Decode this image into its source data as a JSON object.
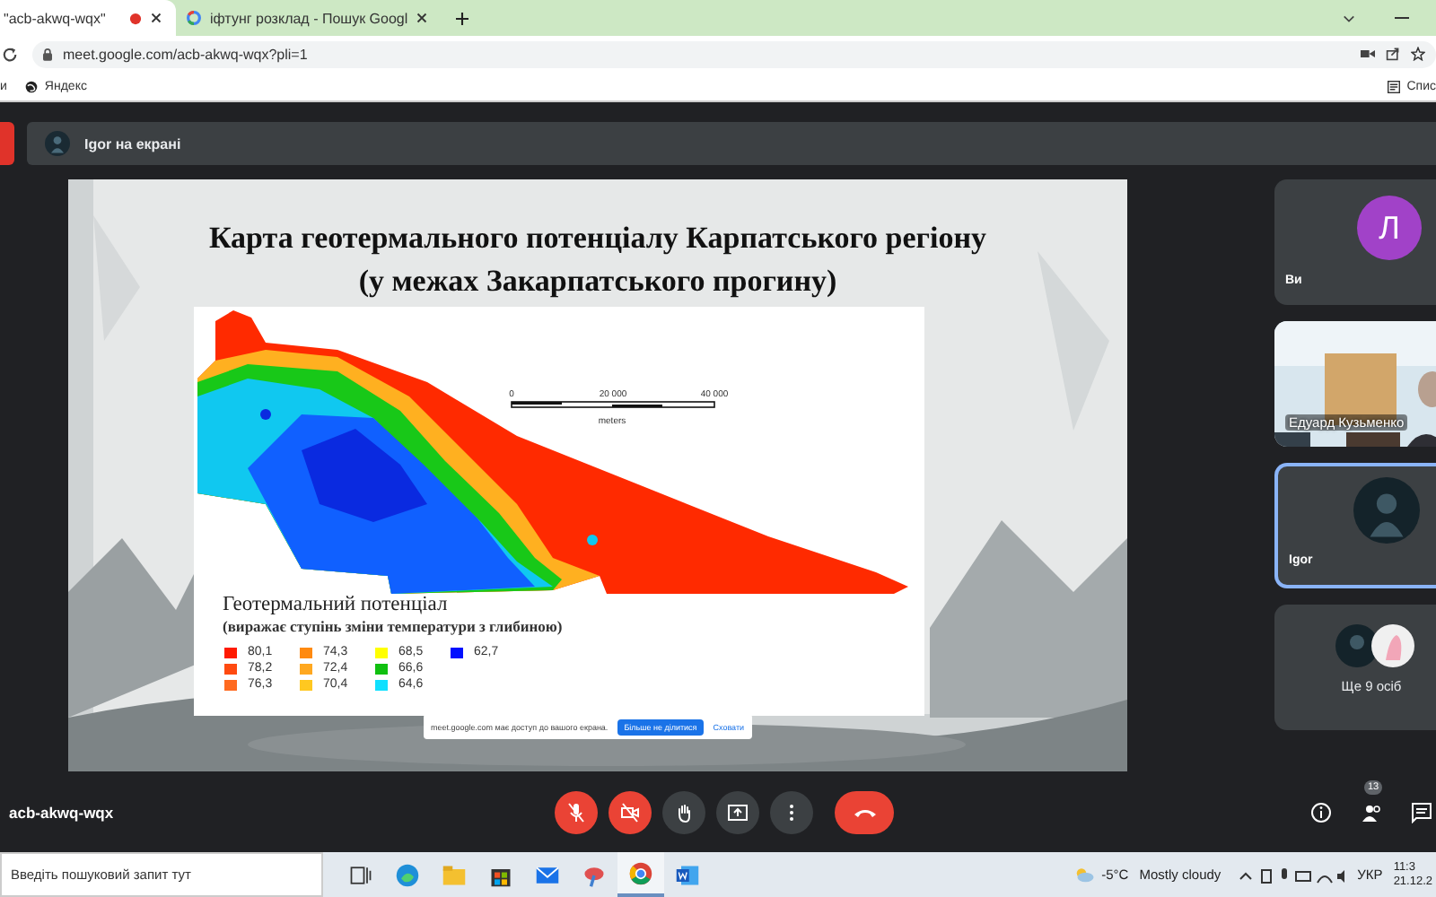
{
  "browser": {
    "tabs": [
      {
        "title": "\"acb-akwq-wqx\"",
        "kind": "meet",
        "recording": true,
        "selected": true
      },
      {
        "title": "іфтунг розклад - Пошук Googl",
        "kind": "google",
        "recording": false,
        "selected": false
      }
    ],
    "url": "meet.google.com/acb-akwq-wqx?pli=1",
    "bookmarks": [
      {
        "label": "и",
        "kind": "plain"
      },
      {
        "label": "Яндекс",
        "kind": "globe"
      }
    ],
    "reading_list": "Спис"
  },
  "meet": {
    "banner": "Igor на екрані",
    "slide": {
      "title": "Карта геотермального потенціалу Карпатського регіону (у межах Закарпатського прогину)",
      "scale_labels": [
        "0",
        "20 000",
        "40 000"
      ],
      "scale_unit": "meters",
      "legend_title": "Геотермальний потенціал",
      "legend_subtitle": "(виражає ступінь зміни температури з глибиною)",
      "legend": [
        {
          "label": "80,1",
          "color": "#ff1a00"
        },
        {
          "label": "78,2",
          "color": "#ff4a10"
        },
        {
          "label": "76,3",
          "color": "#ff6a20"
        },
        {
          "label": "74,3",
          "color": "#ff8a10"
        },
        {
          "label": "72,4",
          "color": "#ffa820"
        },
        {
          "label": "70,4",
          "color": "#ffc820"
        },
        {
          "label": "68,5",
          "color": "#ffff00"
        },
        {
          "label": "66,6",
          "color": "#10c010"
        },
        {
          "label": "64,6",
          "color": "#10e0ff"
        },
        {
          "label": "62,7",
          "color": "#0010ff"
        }
      ]
    },
    "share_notice": {
      "text": "meet.google.com має доступ до вашого екрана.",
      "stop_button": "Більше не ділитися",
      "hide_link": "Сховати"
    },
    "participants": [
      {
        "name": "Ви",
        "kind": "letter",
        "initial": "Л",
        "color": "#a142c8",
        "highlighted": false
      },
      {
        "name": "Едуард Кузьменко",
        "kind": "video",
        "highlighted": false
      },
      {
        "name": "Igor",
        "highlighted": true
      }
    ],
    "more_participants": "Ще 9 осіб",
    "meeting_code": "acb-akwq-wqx",
    "controls": [
      {
        "kind": "mic",
        "off": true
      },
      {
        "kind": "camera",
        "off": true
      },
      {
        "kind": "hand",
        "off": false
      },
      {
        "kind": "present",
        "off": false
      },
      {
        "kind": "more",
        "off": false
      },
      {
        "kind": "hangup",
        "off": false
      }
    ],
    "people_count": "13"
  },
  "taskbar": {
    "search_placeholder": "Введіть пошуковий запит тут",
    "apps": [
      {
        "kind": "taskview",
        "selected": false
      },
      {
        "kind": "edge",
        "selected": false
      },
      {
        "kind": "folder",
        "selected": false
      },
      {
        "kind": "store",
        "selected": false
      },
      {
        "kind": "mail",
        "selected": false
      },
      {
        "kind": "paint",
        "selected": false
      },
      {
        "kind": "chrome",
        "selected": true
      },
      {
        "kind": "word",
        "selected": false
      }
    ],
    "temperature": "-5°C",
    "weather": "Mostly cloudy",
    "language": "УКР",
    "time": "11:3",
    "date": "21.12.2"
  }
}
